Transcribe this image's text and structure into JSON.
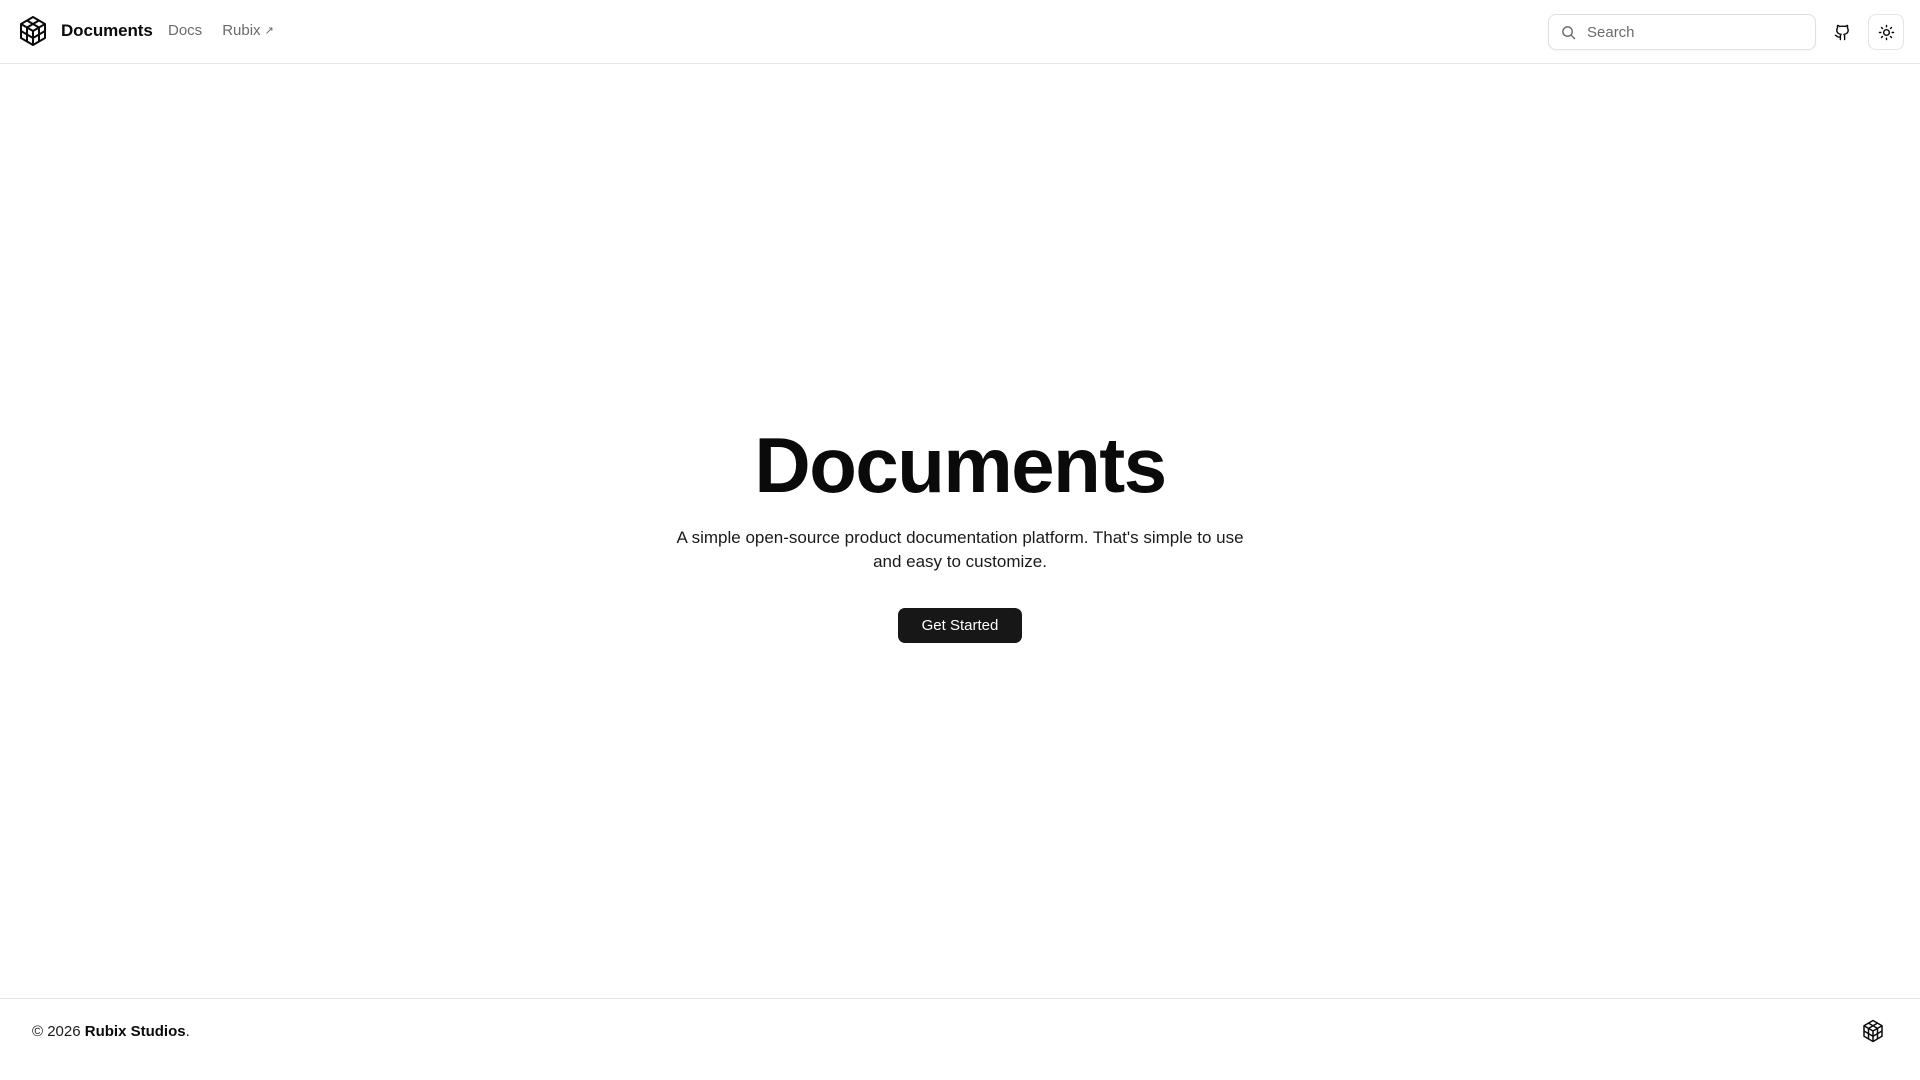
{
  "header": {
    "brand_name": "Documents",
    "nav": [
      {
        "label": "Docs"
      },
      {
        "label": "Rubix",
        "external_icon": "arrow-up-right-icon"
      }
    ],
    "search": {
      "placeholder": "Search",
      "value": "",
      "icon": "search-icon"
    },
    "github_icon": "github-icon",
    "theme_icon": "sun-icon"
  },
  "hero": {
    "title": "Documents",
    "subtitle": "A simple open-source product documentation platform. That's simple to use and easy to customize.",
    "cta_label": "Get Started"
  },
  "footer": {
    "copyright_prefix": "© 2026 ",
    "company": "Rubix Studios",
    "suffix": ".",
    "logo_icon": "cube-logo-icon"
  },
  "colors": {
    "accent": "#171717",
    "border": "#e5e5e5",
    "muted_text": "#6b6b6b"
  }
}
